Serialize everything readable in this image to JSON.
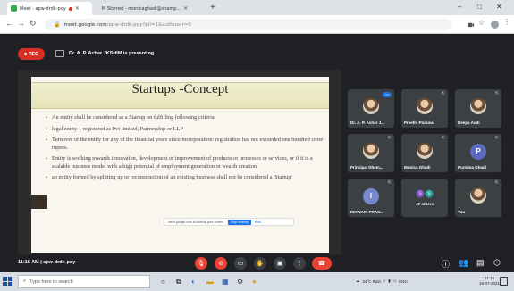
{
  "browser": {
    "tabs": [
      {
        "title": "Meet - apw-drdk-pqy",
        "active": true
      },
      {
        "title": "M  Starred - monicaghadi@shamp...",
        "active": false
      }
    ],
    "url": "meet.google.com",
    "url_rest": "/apw-drdk-pqy?pli=1&authuser=0",
    "window_controls": [
      "–",
      "□",
      "✕"
    ]
  },
  "meet": {
    "rec_label": "REC",
    "presenting_text": "Dr. A. P. Achar JKSHIM is presenting",
    "meeting_time": "11:16 AM",
    "meeting_code": "apw-drdk-pqy"
  },
  "slide": {
    "title": "Startups -Concept",
    "bullets": [
      "An entity shall be considered as a Startup on fulfilling following criteria",
      "legal entity – registered as Pvt limited, Partnership or LLP",
      "Turnover of the entity for any of the financial years since incorporation/ registration has not exceeded one hundred crore rupees.",
      "Entity is working towards innovation, development or improvement of products or processes or services, or if it is a scalable business model with a high potential of employment generation or wealth creation.",
      "an entity formed by splitting up or reconstruction of an existing business shall not be considered a 'Startup'"
    ],
    "share_notice": "meet.google.com is sharing your screen.",
    "stop_label": "Stop sharing",
    "hide_label": "Hide"
  },
  "participants": [
    {
      "name": "Dr. A. P. Achar J...",
      "kind": "photo",
      "color": "#3c4043"
    },
    {
      "name": "Preethi Poduval",
      "kind": "photo",
      "color": "#3c4043"
    },
    {
      "name": "Deepa Audi",
      "kind": "photo",
      "color": "#3c4043"
    },
    {
      "name": "Principal Dhem...",
      "kind": "photo",
      "color": "#3c4043"
    },
    {
      "name": "Monica Ghadi",
      "kind": "photo",
      "color": "#3c4043"
    },
    {
      "name": "Purnima Ghadi",
      "kind": "letter",
      "letter": "P",
      "color": "#5c6bc0"
    },
    {
      "name": "ISHWARI PRAS...",
      "kind": "letter",
      "letter": "I",
      "color": "#7986cb"
    },
    {
      "name": "47 others",
      "kind": "others"
    },
    {
      "name": "You",
      "kind": "photo",
      "color": "#3c4043"
    }
  ],
  "others_badges": [
    {
      "letter": "S",
      "color": "#7e57c2"
    },
    {
      "letter": "S",
      "color": "#26a69a"
    }
  ],
  "taskbar": {
    "search_placeholder": "Type here to search",
    "tray_text": "24°C Rain",
    "lang": "ENG",
    "time": "11:16",
    "date": "16-07-2021"
  },
  "colors": {
    "meet_bg": "#202124",
    "danger": "#ea4335",
    "accent": "#1a73e8"
  }
}
